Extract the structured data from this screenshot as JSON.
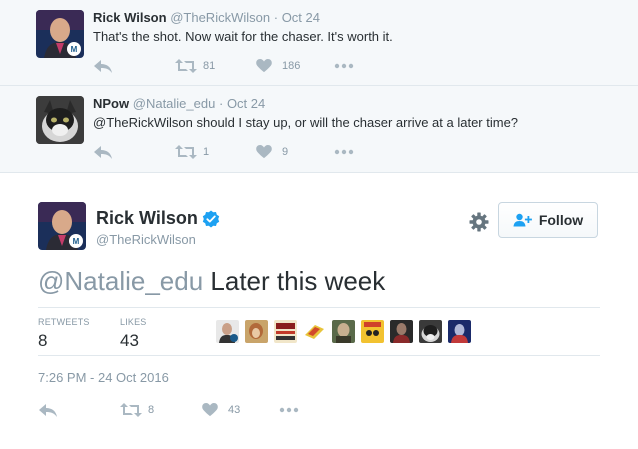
{
  "replies": [
    {
      "name": "Rick Wilson",
      "handle": "@TheRickWilson",
      "dot": "·",
      "time": "Oct 24",
      "text": "That's the shot. Now wait for the chaser. It's worth it.",
      "retweets": "81",
      "likes": "186"
    },
    {
      "name": "NPow",
      "handle": "@Natalie_edu",
      "dot": "·",
      "time": "Oct 24",
      "text": "@TheRickWilson should I stay up, or will the chaser arrive at a later time?",
      "retweets": "1",
      "likes": "9"
    }
  ],
  "main": {
    "name": "Rick Wilson",
    "handle": "@TheRickWilson",
    "follow_label": "Follow",
    "text_mention": "@Natalie_edu",
    "text_rest": " Later this week",
    "retweets_label": "RETWEETS",
    "retweets": "8",
    "likes_label": "LIKES",
    "likes": "43",
    "timestamp": "7:26 PM - 24 Oct 2016",
    "action_retweets": "8",
    "action_likes": "43"
  },
  "colors": {
    "accent": "#1da1f2",
    "muted": "#8899a6",
    "text": "#292f33"
  },
  "icons": [
    "reply-icon",
    "retweet-icon",
    "heart-icon",
    "more-icon",
    "verified-icon",
    "gear-icon",
    "follow-person-icon"
  ]
}
